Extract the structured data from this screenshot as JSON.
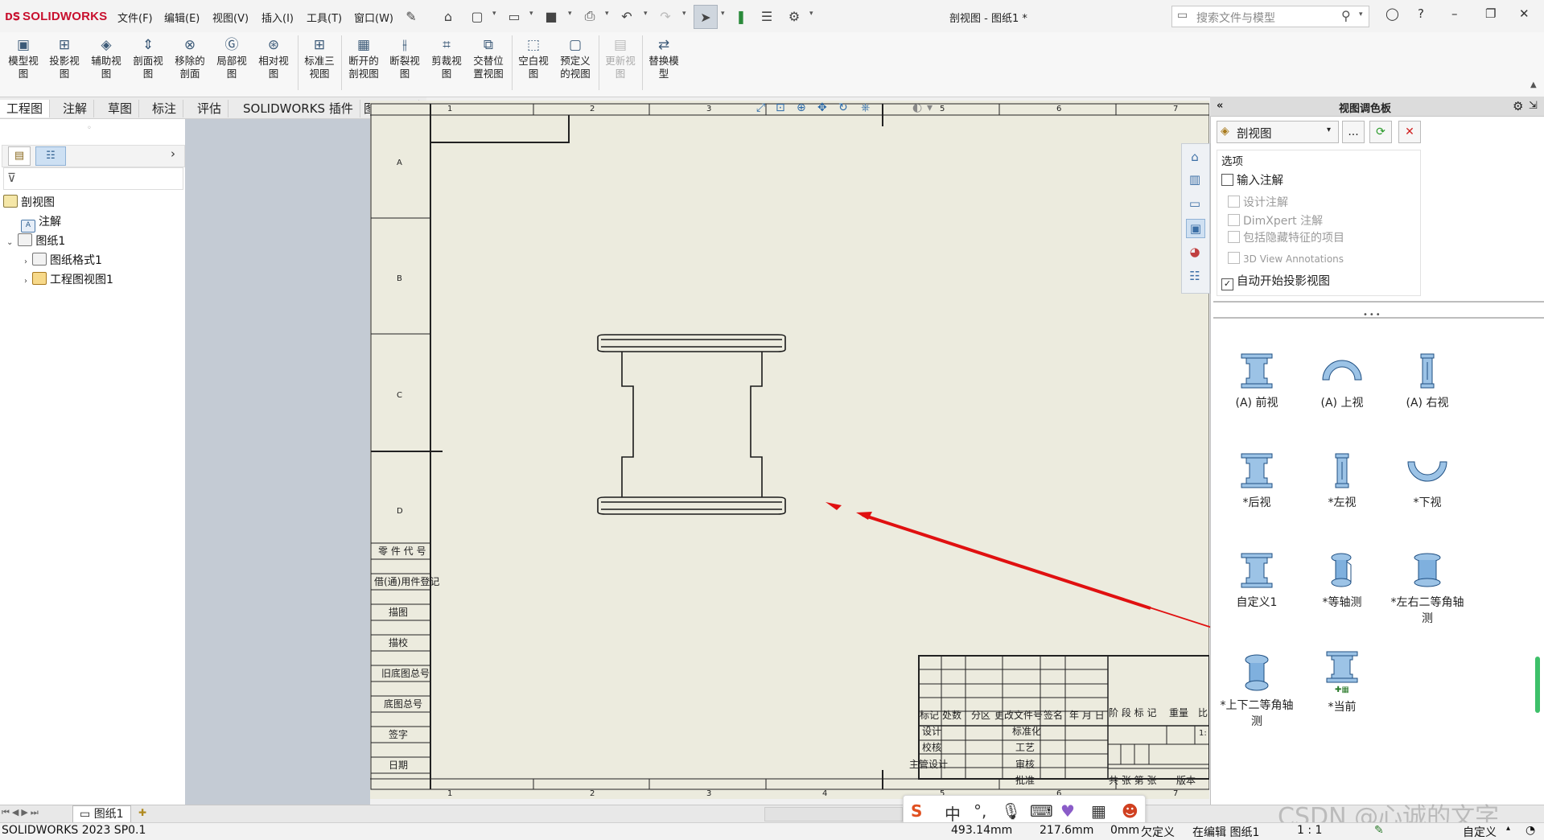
{
  "app": {
    "logo": "SOLIDWORKS",
    "doc_title": "剖视图 - 图纸1 *",
    "search_placeholder": "搜索文件与模型",
    "menus": [
      "文件(F)",
      "编辑(E)",
      "视图(V)",
      "插入(I)",
      "工具(T)",
      "窗口(W)"
    ]
  },
  "ribbon": {
    "buttons": [
      {
        "l1": "模型视",
        "l2": "图"
      },
      {
        "l1": "投影视",
        "l2": "图"
      },
      {
        "l1": "辅助视",
        "l2": "图"
      },
      {
        "l1": "剖面视",
        "l2": "图"
      },
      {
        "l1": "移除的",
        "l2": "剖面"
      },
      {
        "l1": "局部视",
        "l2": "图"
      },
      {
        "l1": "相对视",
        "l2": "图"
      },
      {
        "l1": "标准三",
        "l2": "视图"
      },
      {
        "l1": "断开的",
        "l2": "剖视图"
      },
      {
        "l1": "断裂视",
        "l2": "图"
      },
      {
        "l1": "剪裁视",
        "l2": "图"
      },
      {
        "l1": "交替位",
        "l2": "置视图"
      },
      {
        "l1": "空白视",
        "l2": "图"
      },
      {
        "l1": "预定义",
        "l2": "的视图"
      },
      {
        "l1": "更新视",
        "l2": "图"
      },
      {
        "l1": "替换模",
        "l2": "型"
      }
    ]
  },
  "tabs": [
    "工程图",
    "注解",
    "草图",
    "标注",
    "评估",
    "SOLIDWORKS 插件",
    "图纸格式"
  ],
  "tree": {
    "root": "剖视图",
    "annotations": "注解",
    "sheet": "图纸1",
    "sheet_format": "图纸格式1",
    "drawing_view": "工程图视图1"
  },
  "sheet": {
    "col_labels": [
      "1",
      "2",
      "3",
      "4",
      "5",
      "6",
      "7"
    ],
    "row_labels": [
      "A",
      "B",
      "C",
      "D"
    ],
    "left_block": [
      "零 件 代 号",
      "借(通)用件登记",
      "描图",
      "描校",
      "旧底图总号",
      "底图总号",
      "签字",
      "日期"
    ],
    "title_block": {
      "headers": [
        "标记",
        "处数",
        "分区",
        "更改文件号",
        "签名",
        "年 月 日"
      ],
      "rows": [
        "设计",
        "校核",
        "主管设计"
      ],
      "mid": [
        "标准化",
        "工艺",
        "审核",
        "批准"
      ],
      "right_headers": [
        "阶 段 标 记",
        "重量",
        "比"
      ],
      "scale_hint": "1:",
      "bottom": "共  张 第  张",
      "version": "版本"
    }
  },
  "palette": {
    "title": "视图调色板",
    "combo_value": "剖视图",
    "combo_more": "...",
    "options_title": "选项",
    "options": [
      {
        "label": "输入注解",
        "checked": false,
        "enabled": true
      },
      {
        "label": "设计注解",
        "checked": false,
        "enabled": false
      },
      {
        "label": "DimXpert 注解",
        "checked": false,
        "enabled": false
      },
      {
        "label": "包括隐藏特征的项目",
        "checked": false,
        "enabled": false
      },
      {
        "label": "3D View Annotations",
        "checked": false,
        "enabled": false
      },
      {
        "label": "自动开始投影视图",
        "checked": true,
        "enabled": true
      }
    ],
    "views": [
      {
        "label": "(A) 前视",
        "icon": "front-view-icon"
      },
      {
        "label": "(A) 上视",
        "icon": "top-view-icon"
      },
      {
        "label": "(A) 右视",
        "icon": "right-view-icon"
      },
      {
        "label": "*后视",
        "icon": "back-view-icon"
      },
      {
        "label": "*左视",
        "icon": "left-view-icon"
      },
      {
        "label": "*下视",
        "icon": "bottom-view-icon"
      },
      {
        "label": "自定义1",
        "icon": "custom-view-icon"
      },
      {
        "label": "*等轴测",
        "icon": "isometric-view-icon"
      },
      {
        "label": "*左右二等角轴测",
        "icon": "dimetric-lr-view-icon"
      },
      {
        "label": "*上下二等角轴测",
        "icon": "dimetric-tb-view-icon"
      },
      {
        "label": "*当前",
        "icon": "current-view-icon"
      }
    ]
  },
  "sheetbar": {
    "sheet_tab": "图纸1"
  },
  "status": {
    "version": "SOLIDWORKS 2023 SP0.1",
    "x": "493.14mm",
    "y": "217.6mm",
    "z": "0mm",
    "state": "欠定义",
    "editing": "在编辑 图纸1",
    "scale": "1 : 1",
    "custom": "自定义"
  },
  "ime": {
    "lang": "中"
  },
  "watermark": "CSDN @心诚的文字",
  "colors": {
    "brand": "#c8102e",
    "accent": "#2c6aa8",
    "arrow": "#e01010",
    "sheet_bg": "#ecebde",
    "view_blue": "#9cc3e6"
  }
}
